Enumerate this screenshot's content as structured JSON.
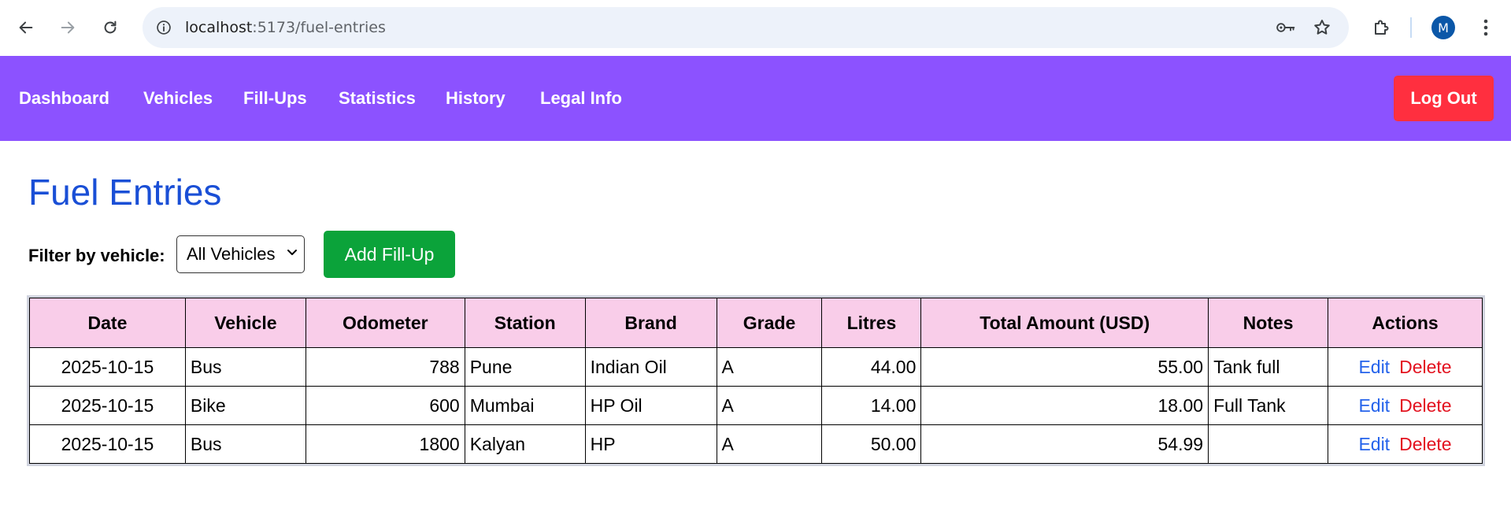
{
  "browser": {
    "url_host": "localhost",
    "url_path": ":5173/fuel-entries",
    "avatar_letter": "M"
  },
  "navbar": {
    "links": [
      "Dashboard",
      "Vehicles",
      "Fill-Ups",
      "Statistics",
      "History",
      "Legal Info"
    ],
    "logout_label": "Log Out"
  },
  "page": {
    "title": "Fuel Entries",
    "filter_label": "Filter by vehicle:",
    "filter_selected": "All Vehicles",
    "add_button_label": "Add Fill-Up"
  },
  "table": {
    "headers": [
      "Date",
      "Vehicle",
      "Odometer",
      "Station",
      "Brand",
      "Grade",
      "Litres",
      "Total Amount (USD)",
      "Notes",
      "Actions"
    ],
    "rows": [
      {
        "date": "2025-10-15",
        "vehicle": "Bus",
        "odometer": "788",
        "station": "Pune",
        "brand": "Indian Oil",
        "grade": "A",
        "litres": "44.00",
        "total": "55.00",
        "notes": "Tank full",
        "edit": "Edit",
        "delete": "Delete"
      },
      {
        "date": "2025-10-15",
        "vehicle": "Bike",
        "odometer": "600",
        "station": "Mumbai",
        "brand": "HP Oil",
        "grade": "A",
        "litres": "14.00",
        "total": "18.00",
        "notes": "Full Tank",
        "edit": "Edit",
        "delete": "Delete"
      },
      {
        "date": "2025-10-15",
        "vehicle": "Bus",
        "odometer": "1800",
        "station": "Kalyan",
        "brand": "HP",
        "grade": "A",
        "litres": "50.00",
        "total": "54.99",
        "notes": "",
        "edit": "Edit",
        "delete": "Delete"
      }
    ]
  },
  "colors": {
    "navbar_bg": "#8c52ff",
    "logout_bg": "#ff2f3f",
    "add_button_bg": "#0ba33a",
    "title_color": "#1a4fd6",
    "table_header_bg": "#f9cde9",
    "edit_color": "#2563eb",
    "delete_color": "#e3121f"
  },
  "icons": {
    "back": "arrow-left-icon",
    "forward": "arrow-right-icon",
    "reload": "reload-icon",
    "site_info": "info-icon",
    "password": "key-icon",
    "bookmark": "star-icon",
    "extensions": "puzzle-icon",
    "menu": "kebab-menu-icon",
    "select_chevron": "chevron-down-icon"
  }
}
